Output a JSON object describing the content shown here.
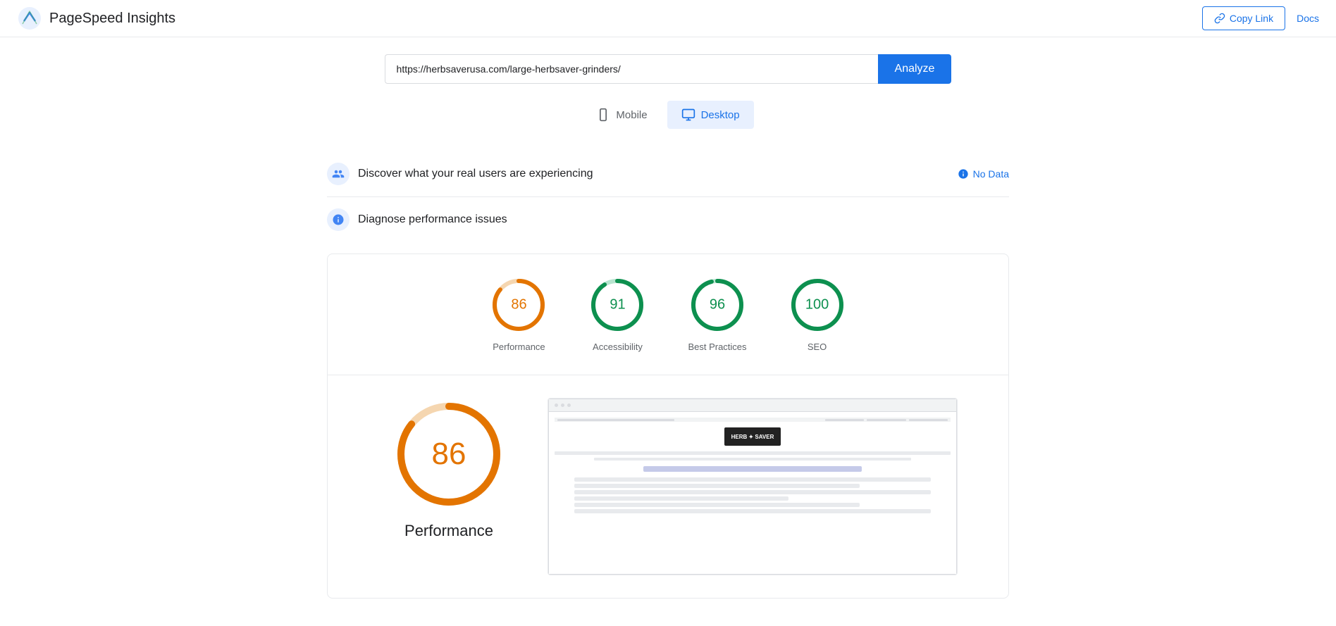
{
  "header": {
    "logo_text": "PageSpeed Insights",
    "copy_link_label": "Copy Link",
    "docs_label": "Docs"
  },
  "url_bar": {
    "url_value": "https://herbsaverusa.com/large-herbsaver-grinders/",
    "analyze_label": "Analyze"
  },
  "device_tabs": [
    {
      "id": "mobile",
      "label": "Mobile",
      "active": false
    },
    {
      "id": "desktop",
      "label": "Desktop",
      "active": true
    }
  ],
  "real_users_section": {
    "title": "Discover what your real users are experiencing",
    "no_data_label": "No Data"
  },
  "diagnose_section": {
    "title": "Diagnose performance issues"
  },
  "scores": [
    {
      "id": "performance",
      "value": 86,
      "label": "Performance",
      "color": "#e37400",
      "track_color": "#f5d6b0",
      "pct": 86
    },
    {
      "id": "accessibility",
      "value": 91,
      "label": "Accessibility",
      "color": "#0d904f",
      "track_color": "#b7e5cf",
      "pct": 91
    },
    {
      "id": "best_practices",
      "value": 96,
      "label": "Best Practices",
      "color": "#0d904f",
      "track_color": "#b7e5cf",
      "pct": 96
    },
    {
      "id": "seo",
      "value": 100,
      "label": "SEO",
      "color": "#0d904f",
      "track_color": "#b7e5cf",
      "pct": 100
    }
  ],
  "big_score": {
    "value": 86,
    "label": "Performance",
    "color": "#e37400",
    "track_color": "#f5d6b0",
    "pct": 86
  },
  "screenshot": {
    "alt": "Website screenshot of herbsaverusa.com"
  }
}
